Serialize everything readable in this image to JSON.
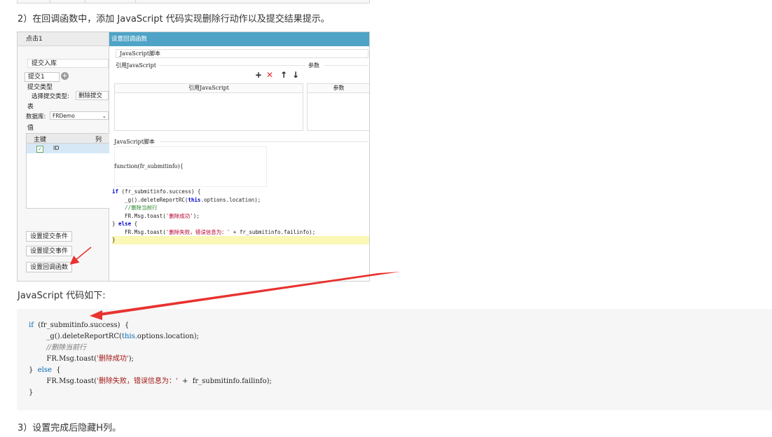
{
  "top_strip": {},
  "step2": {
    "text": "2）在回调函数中，添加 JavaScript 代码实现删除行动作以及提交结果提示。"
  },
  "screenshot": {
    "left_panel": {
      "title": "点击1",
      "submit_to_db": "提交入库",
      "tab": "提交1",
      "submit_type_label": "提交类型",
      "choose_type_label": "选择提交类型:",
      "choose_type_value": "删除提交",
      "table_label": "表",
      "db_label": "数据库:",
      "db_value": "FRDemo",
      "value_label": "值",
      "col_primary_key": "主键",
      "col_column": "列",
      "row_id": "ID",
      "btn_condition": "设置提交条件",
      "btn_event": "设置提交事件",
      "btn_callback": "设置回调函数"
    },
    "right_panel": {
      "header": "设置回调函数",
      "name_field": "JavaScript脚本",
      "ref_js_label": "引用JavaScript",
      "params_label": "参数",
      "ref_js_header": "引用JavaScript",
      "params_header": "参数",
      "js_script_label": "JavaScript脚本",
      "function_sig": "function(fr_submitinfo){",
      "code": [
        "if (fr_submitinfo.success) {",
        "    _g().deleteReportRC(this.options.location);",
        "    //删除当前行",
        "    FR.Msg.toast('删除成功');",
        "} else {",
        "    FR.Msg.toast('删除失败，错误信息为：' + fr_submitinfo.failinfo);",
        "}"
      ]
    }
  },
  "code_intro": {
    "text": "JavaScript 代码如下:"
  },
  "code_block": {
    "lines": [
      "if  (fr_submitinfo.success)  {",
      "        _g().deleteReportRC(this.options.location);",
      "        //删除当前行",
      "        FR.Msg.toast('删除成功');",
      "}  else  {",
      "        FR.Msg.toast('删除失败，错误信息为：'  +  fr_submitinfo.failinfo);",
      "}"
    ]
  },
  "step3": {
    "text": "3）设置完成后隐藏H列。"
  },
  "colors": {
    "arrow": "#e8322f",
    "panel_header": "#4ea3c7",
    "code_bg": "#f6f6f6",
    "highlight": "#fbf7b6"
  }
}
